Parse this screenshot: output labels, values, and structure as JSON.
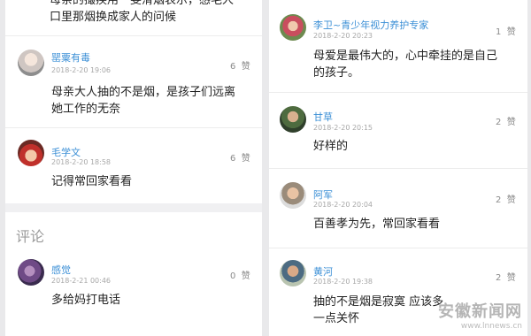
{
  "left_column": {
    "top_partial": {
      "line1": "母亲的撮疾用一斐滑烟表示，感毛人",
      "line2": "口里那烟换成家人的问候"
    },
    "comments": [
      {
        "name": "罂粟有毒",
        "time": "2018-2-20 19:06",
        "likes": "6",
        "like_label": "赞",
        "line1": "母亲大人抽的不是烟，是孩子们远离",
        "line2": "她工作的无奈"
      },
      {
        "name": "毛学文",
        "time": "2018-2-20 18:58",
        "likes": "6",
        "like_label": "赞",
        "line1": "记得常回家看看",
        "line2": ""
      }
    ],
    "section_title": "评论",
    "section_comments": [
      {
        "name": "感觉",
        "time": "2018-2-21 00:46",
        "likes": "0",
        "like_label": "赞",
        "line1": "多给妈打电话",
        "line2": ""
      }
    ]
  },
  "right_column": {
    "comments": [
      {
        "name": "李卫~青少年视力养护专家",
        "time": "2018-2-20 20:23",
        "likes": "1",
        "like_label": "赞",
        "line1": "母爱是最伟大的，心中牵挂的是自己",
        "line2": "的孩子。"
      },
      {
        "name": "甘草",
        "time": "2018-2-20 20:15",
        "likes": "2",
        "like_label": "赞",
        "line1": "好样的",
        "line2": ""
      },
      {
        "name": "阿军",
        "time": "2018-2-20 20:04",
        "likes": "2",
        "like_label": "赞",
        "line1": "百善孝为先，常回家看看",
        "line2": ""
      },
      {
        "name": "黄河",
        "time": "2018-2-20 19:38",
        "likes": "2",
        "like_label": "赞",
        "line1": "抽的不是烟是寂寞 应该多",
        "line2": "一点关怀"
      }
    ]
  },
  "watermark": {
    "text": "安徽新闻网",
    "url": "www.lnnews.cn"
  }
}
